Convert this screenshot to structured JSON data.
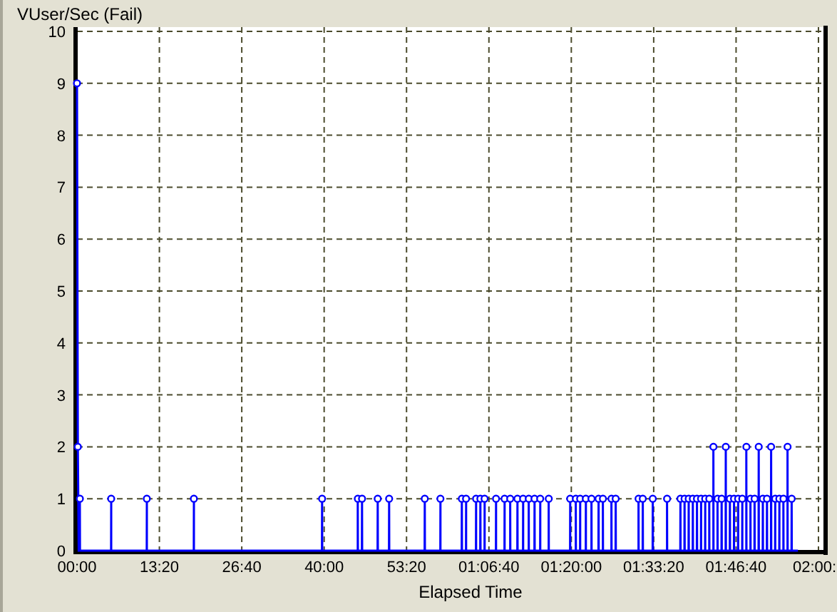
{
  "chart": {
    "chart_data": {
      "type": "line",
      "title": "VUser/Sec (Fail)",
      "xlabel": "Elapsed Time",
      "xlim": [
        0,
        7200
      ],
      "ylim": [
        0,
        10
      ],
      "xticks": [
        {
          "value": 0,
          "label": "00:00"
        },
        {
          "value": 800,
          "label": "13:20"
        },
        {
          "value": 1600,
          "label": "26:40"
        },
        {
          "value": 2400,
          "label": "40:00"
        },
        {
          "value": 3200,
          "label": "53:20"
        },
        {
          "value": 4000,
          "label": "01:06:40"
        },
        {
          "value": 4800,
          "label": "01:20:00"
        },
        {
          "value": 5600,
          "label": "01:33:20"
        },
        {
          "value": 6400,
          "label": "01:46:40"
        },
        {
          "value": 7200,
          "label": "02:00:"
        }
      ],
      "yticks": [
        0,
        1,
        2,
        3,
        4,
        5,
        6,
        7,
        8,
        9,
        10
      ],
      "grid": true,
      "x": [
        0,
        8,
        16,
        27,
        28,
        29,
        331,
        332,
        333,
        677,
        678,
        679,
        1134,
        1135,
        1136,
        2379,
        2380,
        2381,
        2726,
        2727,
        2728,
        2767,
        2768,
        2769,
        2919,
        2920,
        2921,
        3030,
        3031,
        3032,
        3376,
        3377,
        3378,
        3528,
        3529,
        3530,
        3736,
        3737,
        3738,
        3777,
        3778,
        3779,
        3874,
        3875,
        3876,
        3916,
        3917,
        3918,
        3957,
        3958,
        3959,
        4068,
        4069,
        4070,
        4151,
        4152,
        4153,
        4206,
        4207,
        4208,
        4276,
        4277,
        4278,
        4331,
        4332,
        4333,
        4386,
        4387,
        4388,
        4442,
        4443,
        4444,
        4497,
        4498,
        4499,
        4580,
        4581,
        4582,
        4788,
        4789,
        4790,
        4843,
        4844,
        4845,
        4885,
        4886,
        4887,
        4940,
        4941,
        4942,
        4995,
        4996,
        4997,
        5064,
        5065,
        5066,
        5106,
        5107,
        5108,
        5189,
        5190,
        5191,
        5230,
        5231,
        5232,
        5452,
        5453,
        5454,
        5493,
        5494,
        5495,
        5590,
        5591,
        5592,
        5729,
        5730,
        5731,
        5859,
        5860,
        5861,
        5899,
        5900,
        5901,
        5939,
        5940,
        5941,
        5979,
        5980,
        5981,
        6019,
        6020,
        6021,
        6059,
        6060,
        6061,
        6099,
        6100,
        6101,
        6139,
        6140,
        6141,
        6179,
        6180,
        6181,
        6219,
        6220,
        6221,
        6259,
        6260,
        6261,
        6299,
        6300,
        6301,
        6339,
        6340,
        6341,
        6379,
        6380,
        6381,
        6419,
        6420,
        6421,
        6459,
        6460,
        6461,
        6499,
        6500,
        6501,
        6539,
        6540,
        6541,
        6579,
        6580,
        6581,
        6619,
        6620,
        6621,
        6659,
        6660,
        6661,
        6699,
        6700,
        6701,
        6739,
        6740,
        6741,
        6779,
        6780,
        6781,
        6819,
        6820,
        6821,
        6859,
        6860,
        6861,
        6899,
        6900,
        6901,
        6939,
        6940,
        6941,
        7000
      ],
      "series": [
        {
          "color": "#0000ff",
          "values": [
            9,
            2,
            0,
            0,
            1,
            0,
            0,
            1,
            0,
            0,
            1,
            0,
            0,
            1,
            0,
            0,
            1,
            0,
            0,
            1,
            0,
            0,
            1,
            0,
            0,
            1,
            0,
            0,
            1,
            0,
            0,
            1,
            0,
            0,
            1,
            0,
            0,
            1,
            0,
            0,
            1,
            0,
            0,
            1,
            0,
            0,
            1,
            0,
            0,
            1,
            0,
            0,
            1,
            0,
            0,
            1,
            0,
            0,
            1,
            0,
            0,
            1,
            0,
            0,
            1,
            0,
            0,
            1,
            0,
            0,
            1,
            0,
            0,
            1,
            0,
            0,
            1,
            0,
            0,
            1,
            0,
            0,
            1,
            0,
            0,
            1,
            0,
            0,
            1,
            0,
            0,
            1,
            0,
            0,
            1,
            0,
            0,
            1,
            0,
            0,
            1,
            0,
            0,
            1,
            0,
            0,
            1,
            0,
            0,
            1,
            0,
            0,
            1,
            0,
            0,
            1,
            0,
            0,
            1,
            0,
            0,
            1,
            0,
            0,
            1,
            0,
            0,
            1,
            0,
            0,
            1,
            0,
            0,
            1,
            0,
            0,
            1,
            0,
            0,
            1,
            0,
            0,
            2,
            0,
            0,
            1,
            0,
            0,
            1,
            0,
            0,
            2,
            0,
            0,
            1,
            0,
            0,
            1,
            0,
            0,
            1,
            0,
            0,
            1,
            0,
            0,
            2,
            0,
            0,
            1,
            0,
            0,
            1,
            0,
            0,
            2,
            0,
            0,
            1,
            0,
            0,
            1,
            0,
            0,
            2,
            0,
            0,
            1,
            0,
            0,
            1,
            0,
            0,
            1,
            0,
            0,
            2,
            0,
            0,
            1,
            0,
            0
          ]
        }
      ]
    }
  }
}
